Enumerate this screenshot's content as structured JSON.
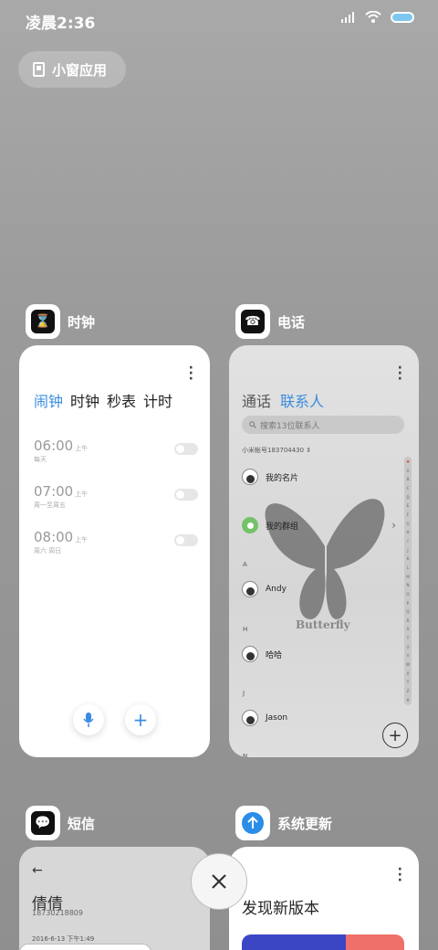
{
  "status_bar": {
    "time": "凌晨2:36"
  },
  "small_window": {
    "label": "小窗应用"
  },
  "clock_app": {
    "name": "时钟",
    "tabs": [
      "闹钟",
      "时钟",
      "秒表",
      "计时"
    ],
    "alarms": [
      {
        "time": "06:00",
        "ampm": "上午",
        "days": "每天"
      },
      {
        "time": "07:00",
        "ampm": "上午",
        "days": "周一至周五"
      },
      {
        "time": "08:00",
        "ampm": "上午",
        "days": "周六 周日"
      }
    ]
  },
  "phone_app": {
    "name": "电话",
    "tabs": [
      "通话",
      "联系人"
    ],
    "search_placeholder": "搜索13位联系人",
    "account": "小米帐号183704430",
    "contacts": {
      "my_card": "我的名片",
      "my_groups": "我的群组",
      "section_a": "A",
      "andy": "Andy",
      "section_h": "H",
      "haha": "哈哈",
      "section_j": "J",
      "jason": "Jason",
      "section_n": "N"
    },
    "butterfly_text": "Butterfly",
    "alpha_index": [
      "♥",
      "A",
      "B",
      "C",
      "D",
      "E",
      "F",
      "G",
      "H",
      "I",
      "J",
      "K",
      "L",
      "M",
      "N",
      "O",
      "P",
      "Q",
      "R",
      "S",
      "T",
      "U",
      "V",
      "W",
      "X",
      "Y",
      "Z",
      "#"
    ]
  },
  "sms_app": {
    "name": "短信",
    "contact_name": "倩倩",
    "contact_number": "18730218809",
    "date": "2016-6-13 下午1:49"
  },
  "update_app": {
    "name": "系统更新",
    "title": "发现新版本"
  },
  "colors": {
    "accent": "#3a8ce0",
    "green": "#73c26a"
  }
}
